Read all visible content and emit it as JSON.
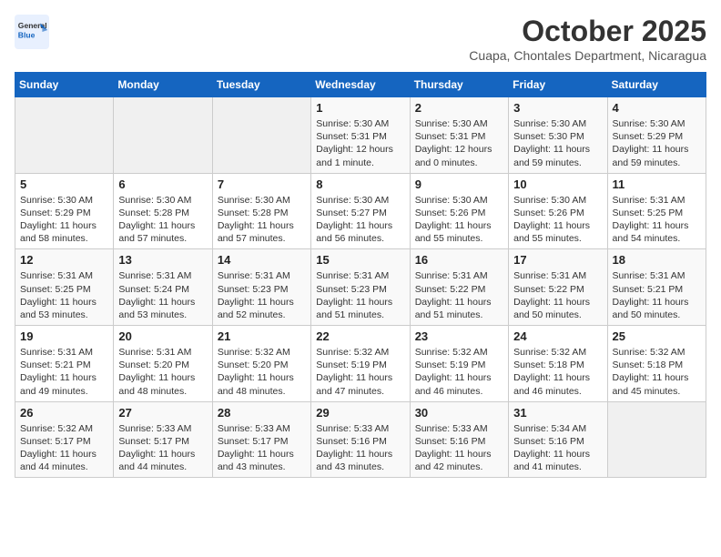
{
  "header": {
    "logo_general": "General",
    "logo_blue": "Blue",
    "month": "October 2025",
    "location": "Cuapa, Chontales Department, Nicaragua"
  },
  "days_of_week": [
    "Sunday",
    "Monday",
    "Tuesday",
    "Wednesday",
    "Thursday",
    "Friday",
    "Saturday"
  ],
  "weeks": [
    [
      {
        "day": "",
        "info": ""
      },
      {
        "day": "",
        "info": ""
      },
      {
        "day": "",
        "info": ""
      },
      {
        "day": "1",
        "info": "Sunrise: 5:30 AM\nSunset: 5:31 PM\nDaylight: 12 hours\nand 1 minute."
      },
      {
        "day": "2",
        "info": "Sunrise: 5:30 AM\nSunset: 5:31 PM\nDaylight: 12 hours\nand 0 minutes."
      },
      {
        "day": "3",
        "info": "Sunrise: 5:30 AM\nSunset: 5:30 PM\nDaylight: 11 hours\nand 59 minutes."
      },
      {
        "day": "4",
        "info": "Sunrise: 5:30 AM\nSunset: 5:29 PM\nDaylight: 11 hours\nand 59 minutes."
      }
    ],
    [
      {
        "day": "5",
        "info": "Sunrise: 5:30 AM\nSunset: 5:29 PM\nDaylight: 11 hours\nand 58 minutes."
      },
      {
        "day": "6",
        "info": "Sunrise: 5:30 AM\nSunset: 5:28 PM\nDaylight: 11 hours\nand 57 minutes."
      },
      {
        "day": "7",
        "info": "Sunrise: 5:30 AM\nSunset: 5:28 PM\nDaylight: 11 hours\nand 57 minutes."
      },
      {
        "day": "8",
        "info": "Sunrise: 5:30 AM\nSunset: 5:27 PM\nDaylight: 11 hours\nand 56 minutes."
      },
      {
        "day": "9",
        "info": "Sunrise: 5:30 AM\nSunset: 5:26 PM\nDaylight: 11 hours\nand 55 minutes."
      },
      {
        "day": "10",
        "info": "Sunrise: 5:30 AM\nSunset: 5:26 PM\nDaylight: 11 hours\nand 55 minutes."
      },
      {
        "day": "11",
        "info": "Sunrise: 5:31 AM\nSunset: 5:25 PM\nDaylight: 11 hours\nand 54 minutes."
      }
    ],
    [
      {
        "day": "12",
        "info": "Sunrise: 5:31 AM\nSunset: 5:25 PM\nDaylight: 11 hours\nand 53 minutes."
      },
      {
        "day": "13",
        "info": "Sunrise: 5:31 AM\nSunset: 5:24 PM\nDaylight: 11 hours\nand 53 minutes."
      },
      {
        "day": "14",
        "info": "Sunrise: 5:31 AM\nSunset: 5:23 PM\nDaylight: 11 hours\nand 52 minutes."
      },
      {
        "day": "15",
        "info": "Sunrise: 5:31 AM\nSunset: 5:23 PM\nDaylight: 11 hours\nand 51 minutes."
      },
      {
        "day": "16",
        "info": "Sunrise: 5:31 AM\nSunset: 5:22 PM\nDaylight: 11 hours\nand 51 minutes."
      },
      {
        "day": "17",
        "info": "Sunrise: 5:31 AM\nSunset: 5:22 PM\nDaylight: 11 hours\nand 50 minutes."
      },
      {
        "day": "18",
        "info": "Sunrise: 5:31 AM\nSunset: 5:21 PM\nDaylight: 11 hours\nand 50 minutes."
      }
    ],
    [
      {
        "day": "19",
        "info": "Sunrise: 5:31 AM\nSunset: 5:21 PM\nDaylight: 11 hours\nand 49 minutes."
      },
      {
        "day": "20",
        "info": "Sunrise: 5:31 AM\nSunset: 5:20 PM\nDaylight: 11 hours\nand 48 minutes."
      },
      {
        "day": "21",
        "info": "Sunrise: 5:32 AM\nSunset: 5:20 PM\nDaylight: 11 hours\nand 48 minutes."
      },
      {
        "day": "22",
        "info": "Sunrise: 5:32 AM\nSunset: 5:19 PM\nDaylight: 11 hours\nand 47 minutes."
      },
      {
        "day": "23",
        "info": "Sunrise: 5:32 AM\nSunset: 5:19 PM\nDaylight: 11 hours\nand 46 minutes."
      },
      {
        "day": "24",
        "info": "Sunrise: 5:32 AM\nSunset: 5:18 PM\nDaylight: 11 hours\nand 46 minutes."
      },
      {
        "day": "25",
        "info": "Sunrise: 5:32 AM\nSunset: 5:18 PM\nDaylight: 11 hours\nand 45 minutes."
      }
    ],
    [
      {
        "day": "26",
        "info": "Sunrise: 5:32 AM\nSunset: 5:17 PM\nDaylight: 11 hours\nand 44 minutes."
      },
      {
        "day": "27",
        "info": "Sunrise: 5:33 AM\nSunset: 5:17 PM\nDaylight: 11 hours\nand 44 minutes."
      },
      {
        "day": "28",
        "info": "Sunrise: 5:33 AM\nSunset: 5:17 PM\nDaylight: 11 hours\nand 43 minutes."
      },
      {
        "day": "29",
        "info": "Sunrise: 5:33 AM\nSunset: 5:16 PM\nDaylight: 11 hours\nand 43 minutes."
      },
      {
        "day": "30",
        "info": "Sunrise: 5:33 AM\nSunset: 5:16 PM\nDaylight: 11 hours\nand 42 minutes."
      },
      {
        "day": "31",
        "info": "Sunrise: 5:34 AM\nSunset: 5:16 PM\nDaylight: 11 hours\nand 41 minutes."
      },
      {
        "day": "",
        "info": ""
      }
    ]
  ]
}
